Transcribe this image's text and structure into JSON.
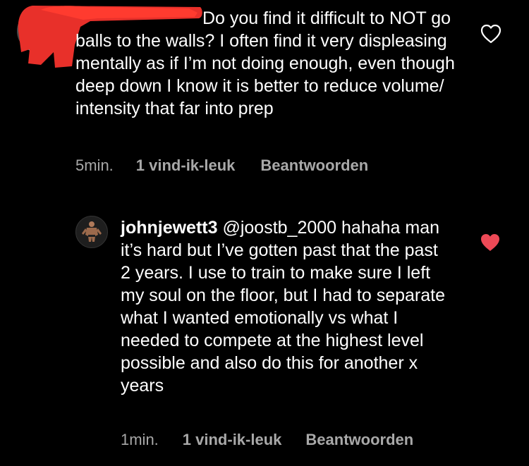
{
  "comments": [
    {
      "avatar_icon": "user-avatar-icon",
      "redacted": true,
      "text": "Do you find it difficult to NOT go balls to the walls? I often find it very displeasing mentally as if I’m not doing enough, even though deep down I know it is better to reduce volume/ intensity that far into prep",
      "time": "5min.",
      "likes": "1 vind-ik-leuk",
      "reply_label": "Beantwoorden",
      "liked": false,
      "heart_color": "#ffffff"
    },
    {
      "avatar_icon": "bodybuilder-avatar-icon",
      "username": "johnjewett3",
      "text": " @joostb_2000 hahaha man it’s hard but I’ve gotten past that the past 2 years. I use to train to make sure I left my soul on the floor, but I had to separate what I wanted emotionally vs what I needed to compete at the highest level possible and also do this for another x years",
      "time": "1min.",
      "likes": "1 vind-ik-leuk",
      "reply_label": "Beantwoorden",
      "liked": true,
      "heart_color": "#ed4956"
    }
  ],
  "colors": {
    "background": "#000000",
    "text": "#ffffff",
    "meta": "#a8a8a8",
    "redaction": "#e8302a",
    "liked": "#ed4956"
  }
}
